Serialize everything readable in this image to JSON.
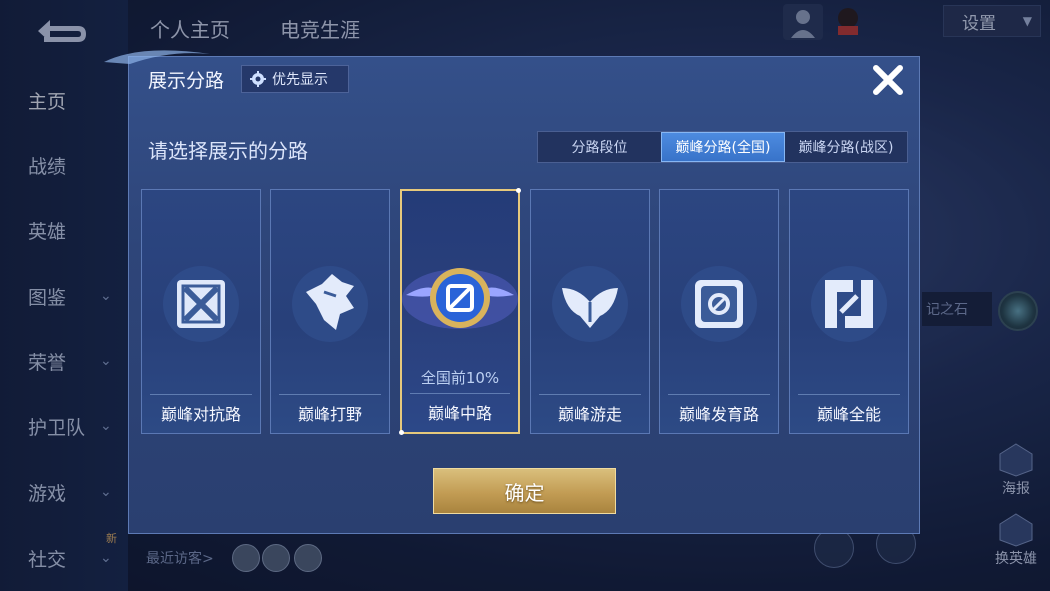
{
  "header": {
    "tabs": [
      "个人主页",
      "电竞生涯"
    ],
    "settings_label": "设置"
  },
  "sidebar": {
    "items": [
      {
        "label": "主页"
      },
      {
        "label": "战绩"
      },
      {
        "label": "英雄"
      },
      {
        "label": "图鉴"
      },
      {
        "label": "荣誉"
      },
      {
        "label": "护卫队"
      },
      {
        "label": "游戏"
      },
      {
        "label": "社交"
      }
    ],
    "new_badge": "新"
  },
  "background": {
    "right_label": "记之石",
    "side_buttons": [
      "海报",
      "换英雄"
    ],
    "recent_visitors_label": "最近访客>"
  },
  "modal": {
    "title": "展示分路",
    "priority_label": "优先显示",
    "subtitle": "请选择展示的分路",
    "segments": [
      {
        "label": "分路段位",
        "selected": false
      },
      {
        "label": "巅峰分路(全国)",
        "selected": true
      },
      {
        "label": "巅峰分路(战区)",
        "selected": false
      }
    ],
    "cards": [
      {
        "label": "巅峰对抗路",
        "icon": "sword-cross-icon",
        "rank": "",
        "selected": false
      },
      {
        "label": "巅峰打野",
        "icon": "dragon-icon",
        "rank": "",
        "selected": false
      },
      {
        "label": "巅峰中路",
        "icon": "mid-lane-emblem-icon",
        "rank": "全国前10%",
        "selected": true
      },
      {
        "label": "巅峰游走",
        "icon": "wings-icon",
        "rank": "",
        "selected": false
      },
      {
        "label": "巅峰发育路",
        "icon": "bow-icon",
        "rank": "",
        "selected": false
      },
      {
        "label": "巅峰全能",
        "icon": "all-round-icon",
        "rank": "",
        "selected": false
      }
    ],
    "confirm_label": "确定"
  },
  "colors": {
    "accent_blue": "#3873c9",
    "gold": "#c29c54",
    "selected_border": "#e6c97c"
  }
}
